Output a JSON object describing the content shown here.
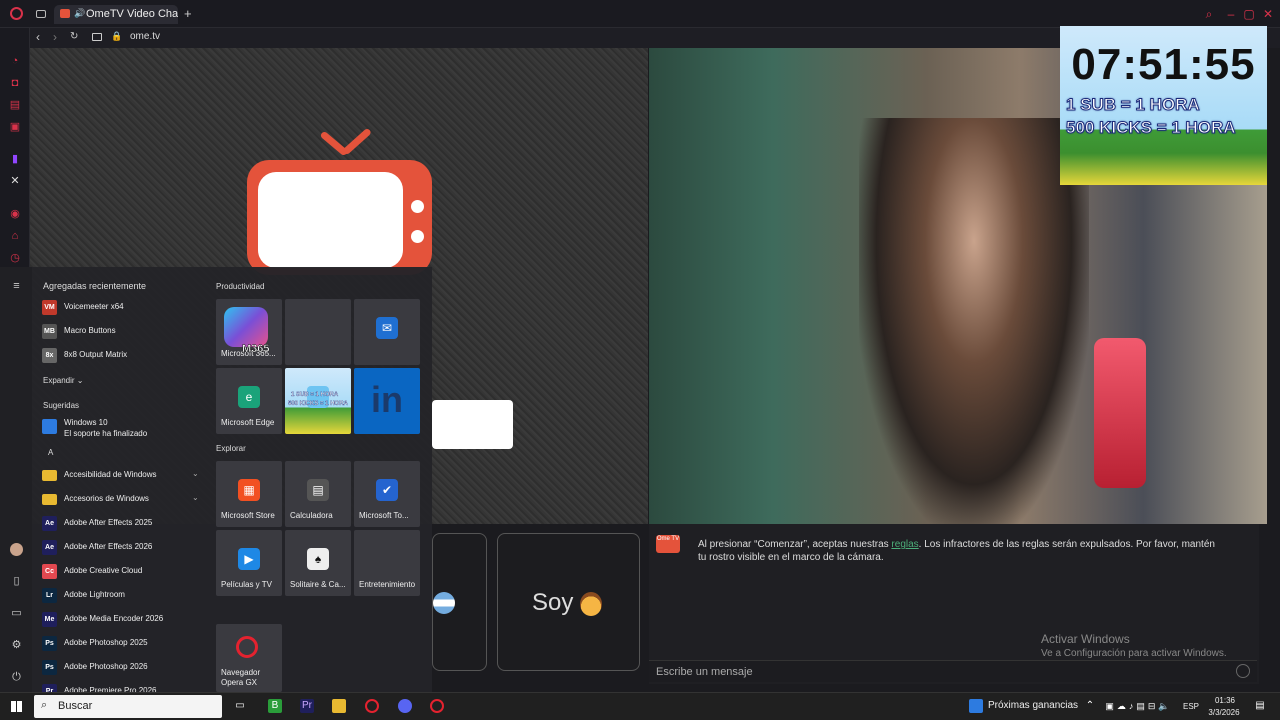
{
  "browser": {
    "tab_title": "OmeTV Video Chat — C",
    "url": "ome.tv"
  },
  "overlay": {
    "timer": "07:51:55",
    "line1": "1 SUB = 1 HORA",
    "line2": "500 KICKS = 1 HORA"
  },
  "page": {
    "chat_text_pre": "Al presionar “Comenzar”, aceptas nuestras ",
    "chat_link": "reglas",
    "chat_text_post": ". Los infractores de las reglas serán expulsados. Por favor, mantén tu rostro visible en el marco de la cámara.",
    "message_placeholder": "Escribe un mensaje",
    "soy_label": "Soy",
    "activate_title": "Activar Windows",
    "activate_sub": "Ve a Configuración para activar Windows.",
    "logo_text": "Ome TV"
  },
  "start_menu": {
    "recent_header": "Agregadas recientemente",
    "recent": [
      {
        "label": "Voicemeeter x64",
        "icon_color": "#c0392b",
        "abbr": "VM"
      },
      {
        "label": "Macro Buttons",
        "icon_color": "#555",
        "abbr": "MB"
      },
      {
        "label": "8x8 Output Matrix",
        "icon_color": "#666",
        "abbr": "8x"
      }
    ],
    "expand_label": "Expandir",
    "suggested_header": "Sugeridas",
    "suggested_title": "Windows 10",
    "suggested_sub": "El soporte ha finalizado",
    "letter_a": "A",
    "apps": [
      {
        "label": "Accesibilidad de Windows",
        "icon_color": "#e8b931",
        "abbr": "",
        "folder": true
      },
      {
        "label": "Accesorios de Windows",
        "icon_color": "#e8b931",
        "abbr": "",
        "folder": true
      },
      {
        "label": "Adobe After Effects 2025",
        "icon_color": "#1f1f5c",
        "abbr": "Ae"
      },
      {
        "label": "Adobe After Effects 2026",
        "icon_color": "#1f1f5c",
        "abbr": "Ae"
      },
      {
        "label": "Adobe Creative Cloud",
        "icon_color": "#e34850",
        "abbr": "Cc"
      },
      {
        "label": "Adobe Lightroom",
        "icon_color": "#0c2740",
        "abbr": "Lr"
      },
      {
        "label": "Adobe Media Encoder 2026",
        "icon_color": "#1f1f5c",
        "abbr": "Me"
      },
      {
        "label": "Adobe Photoshop 2025",
        "icon_color": "#0c2740",
        "abbr": "Ps"
      },
      {
        "label": "Adobe Photoshop 2026",
        "icon_color": "#0c2740",
        "abbr": "Ps"
      },
      {
        "label": "Adobe Premiere Pro 2026",
        "icon_color": "#1f1f5c",
        "abbr": "Pr"
      }
    ],
    "group_productivity": "Productividad",
    "group_explore": "Explorar",
    "tiles_prod": [
      {
        "label": "Microsoft 365...",
        "icon_color": "#7a4fd6",
        "glyph": "M365"
      },
      {
        "label": "",
        "icon_color": "#3a3a40",
        "glyph": ""
      },
      {
        "label": "",
        "icon_color": "#1f6fd1",
        "glyph": "✉"
      },
      {
        "label": "Microsoft Edge",
        "icon_color": "#1aa37a",
        "glyph": "e"
      },
      {
        "label": "",
        "icon_color": "#6ec4f2",
        "glyph": ""
      },
      {
        "label": "",
        "icon_color": "#0a66c2",
        "glyph": "in"
      }
    ],
    "tiles_explore": [
      {
        "label": "Microsoft Store",
        "icon_color": "#f25022",
        "glyph": "▦"
      },
      {
        "label": "Calculadora",
        "icon_color": "#555",
        "glyph": "▤"
      },
      {
        "label": "Microsoft To...",
        "icon_color": "#2564cf",
        "glyph": "✔"
      },
      {
        "label": "Películas y TV",
        "icon_color": "#1e88e5",
        "glyph": "▶"
      },
      {
        "label": "Solitaire & Ca...",
        "icon_color": "#eee",
        "glyph": "♠"
      },
      {
        "label": "Entretenimiento",
        "icon_color": "#3a3a40",
        "glyph": ""
      }
    ],
    "tile_opera": "Navegador Opera GX",
    "tile_m365_badge": "M365",
    "tile_overlay_text1": "1 SUB = 1 HORA",
    "tile_overlay_text2": "500 KICKS = 1 HORA"
  },
  "taskbar": {
    "search_placeholder": "Buscar",
    "earnings": "Próximas ganancias",
    "time": "01:36",
    "date": "3/3/2026",
    "lang": "ESP"
  }
}
